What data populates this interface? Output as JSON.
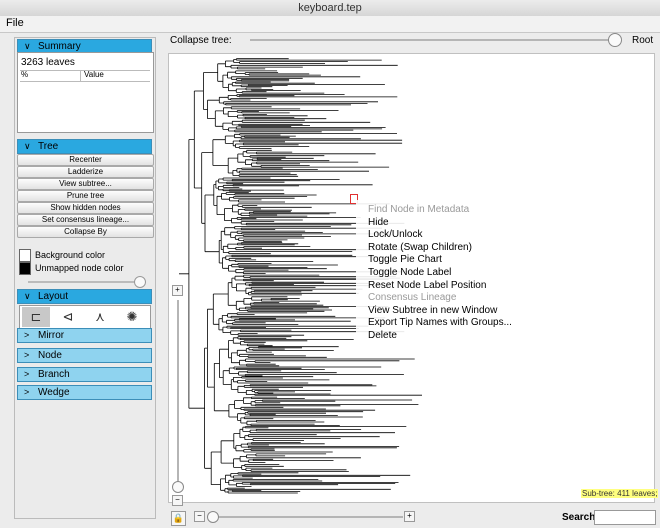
{
  "window": {
    "title": "keyboard.tep"
  },
  "menu": {
    "file": "File"
  },
  "panels": {
    "summary": {
      "label": "Summary",
      "leaves": "3263 leaves",
      "col_pct": "%",
      "col_value": "Value"
    },
    "tree": {
      "label": "Tree",
      "buttons": [
        "Recenter",
        "Ladderize",
        "View subtree...",
        "Prune tree",
        "Show hidden nodes",
        "Set consensus lineage...",
        "Collapse By"
      ],
      "background_color": "Background color",
      "unmapped_color": "Unmapped node color"
    },
    "layout": {
      "label": "Layout",
      "icons": [
        "rectangular-layout-icon",
        "slanted-layout-icon",
        "radial-layout-icon",
        "circular-layout-icon"
      ]
    },
    "mirror": {
      "label": "Mirror"
    },
    "node": {
      "label": "Node"
    },
    "branch": {
      "label": "Branch"
    },
    "wedge": {
      "label": "Wedge"
    }
  },
  "toolbar": {
    "collapse_tree": "Collapse tree:",
    "root": "Root"
  },
  "zoom": {
    "plus": "+",
    "minus": "−"
  },
  "context_menu": [
    {
      "label": "Find Node in Metadata",
      "enabled": false
    },
    {
      "label": "Hide",
      "enabled": true
    },
    {
      "label": "Lock/Unlock",
      "enabled": true
    },
    {
      "label": "Rotate (Swap Children)",
      "enabled": true
    },
    {
      "label": "Toggle Pie Chart",
      "enabled": true
    },
    {
      "label": "Toggle Node Label",
      "enabled": true
    },
    {
      "label": "Reset Node Label Position",
      "enabled": true
    },
    {
      "label": "Consensus Lineage",
      "enabled": false
    },
    {
      "label": "View Subtree in new Window",
      "enabled": true
    },
    {
      "label": "Export Tip Names with Groups...",
      "enabled": true
    },
    {
      "label": "Delete",
      "enabled": true
    }
  ],
  "status": {
    "subtree": "Sub-tree: 411 leaves;"
  },
  "search": {
    "label": "Search:",
    "value": ""
  },
  "colors": {
    "accent": "#2aa8e0",
    "header": "#8fd3ef",
    "background_swatch": "#ffffff",
    "unmapped_swatch": "#000000",
    "node_marker": "#e03030",
    "status_bg": "#ffff80"
  }
}
